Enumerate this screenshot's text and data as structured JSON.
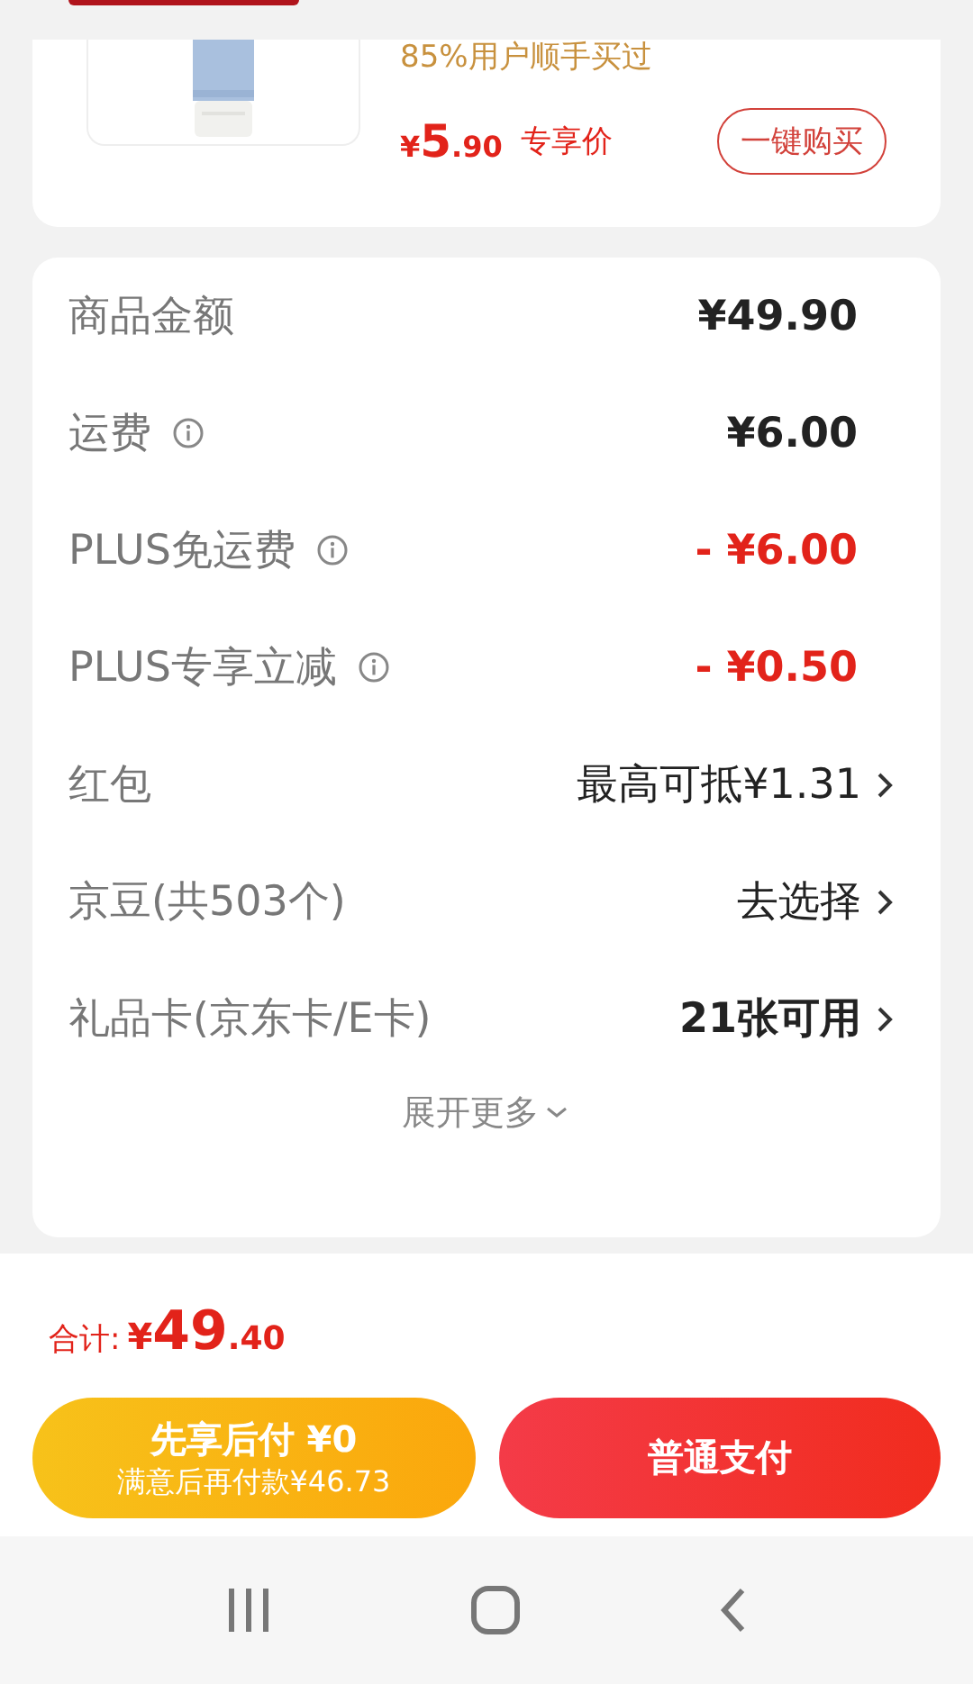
{
  "product": {
    "kind": "picture",
    "note": "85%用户顺手买过",
    "price": {
      "currency": "¥",
      "integer": "5",
      "decimal": ".90"
    },
    "price_label": "专享价",
    "buy_button": "一键购买"
  },
  "summary": {
    "rows": [
      {
        "label": "商品金额",
        "info": false,
        "kind": "amount",
        "value": "¥49.90"
      },
      {
        "label": "运费",
        "info": true,
        "kind": "amount",
        "value": "¥6.00"
      },
      {
        "label": "PLUS免运费",
        "info": true,
        "kind": "deduction",
        "value": "- ¥6.00"
      },
      {
        "label": "PLUS专享立减",
        "info": true,
        "kind": "deduction",
        "value": "- ¥0.50"
      },
      {
        "label": "红包",
        "info": false,
        "kind": "option",
        "value": "最高可抵¥1.31"
      },
      {
        "label": "京豆(共503个)",
        "info": false,
        "kind": "option",
        "value": "去选择"
      },
      {
        "label": "礼品卡(京东卡/E卡)",
        "info": false,
        "kind": "option",
        "value": "21张可用"
      }
    ],
    "expand": "展开更多"
  },
  "total": {
    "label": "合计:",
    "currency": "¥",
    "integer": "49",
    "decimal": ".40"
  },
  "buttons": [
    {
      "kind": "later",
      "title": "先享后付 ¥0",
      "subtitle": "满意后再付款¥46.73"
    },
    {
      "kind": "pay",
      "title": "普通支付"
    }
  ]
}
